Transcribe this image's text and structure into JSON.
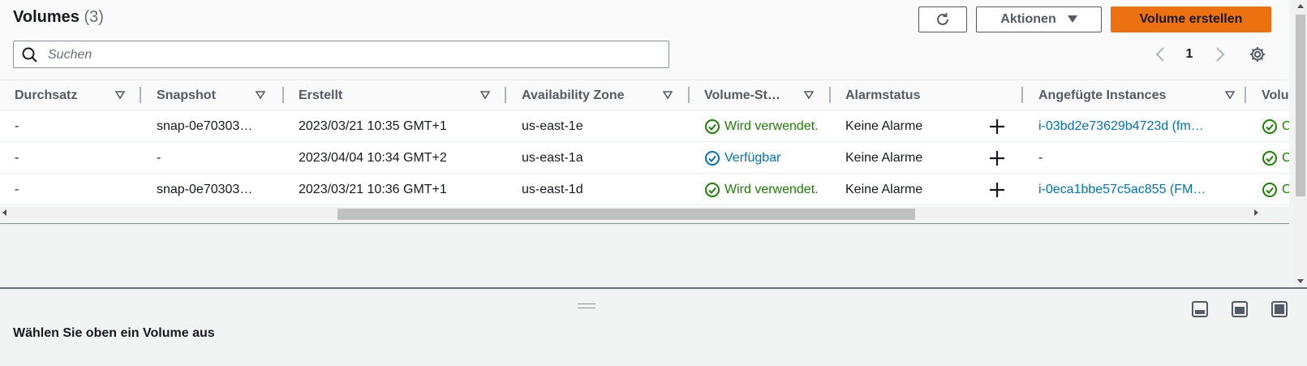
{
  "header": {
    "title": "Volumes",
    "count": "(3)",
    "actions_label": "Aktionen",
    "create_label": "Volume erstellen"
  },
  "search": {
    "placeholder": "Suchen",
    "value": ""
  },
  "pagination": {
    "current_page": "1"
  },
  "table": {
    "columns": [
      "Durchsatz",
      "Snapshot",
      "Erstellt",
      "Availability Zone",
      "Volume-St…",
      "Alarmstatus",
      "Angefügte Instances",
      "Volu"
    ],
    "rows": [
      {
        "durchsatz": "-",
        "snapshot": "snap-0e70303…",
        "erstellt": "2023/03/21 10:35 GMT+1",
        "zone": "us-east-1e",
        "volume_state": "Wird verwendet.",
        "alarm": "Keine Alarme",
        "instance": "i-03bd2e73629b4723d (fm…",
        "volume_status": "C"
      },
      {
        "durchsatz": "-",
        "snapshot": "-",
        "erstellt": "2023/04/04 10:34 GMT+2",
        "zone": "us-east-1a",
        "volume_state": "Verfügbar",
        "alarm": "Keine Alarme",
        "instance": "-",
        "volume_status": "C"
      },
      {
        "durchsatz": "-",
        "snapshot": "snap-0e70303…",
        "erstellt": "2023/03/21 10:36 GMT+1",
        "zone": "us-east-1d",
        "volume_state": "Wird verwendet.",
        "alarm": "Keine Alarme",
        "instance": "i-0eca1bbe57c5ac855 (FM…",
        "volume_status": "C"
      }
    ]
  },
  "detail_panel": {
    "empty_message": "Wählen Sie oben ein Volume aus"
  },
  "colors": {
    "accent": "#ec7211",
    "link": "#0073bb",
    "success": "#1d8102"
  }
}
